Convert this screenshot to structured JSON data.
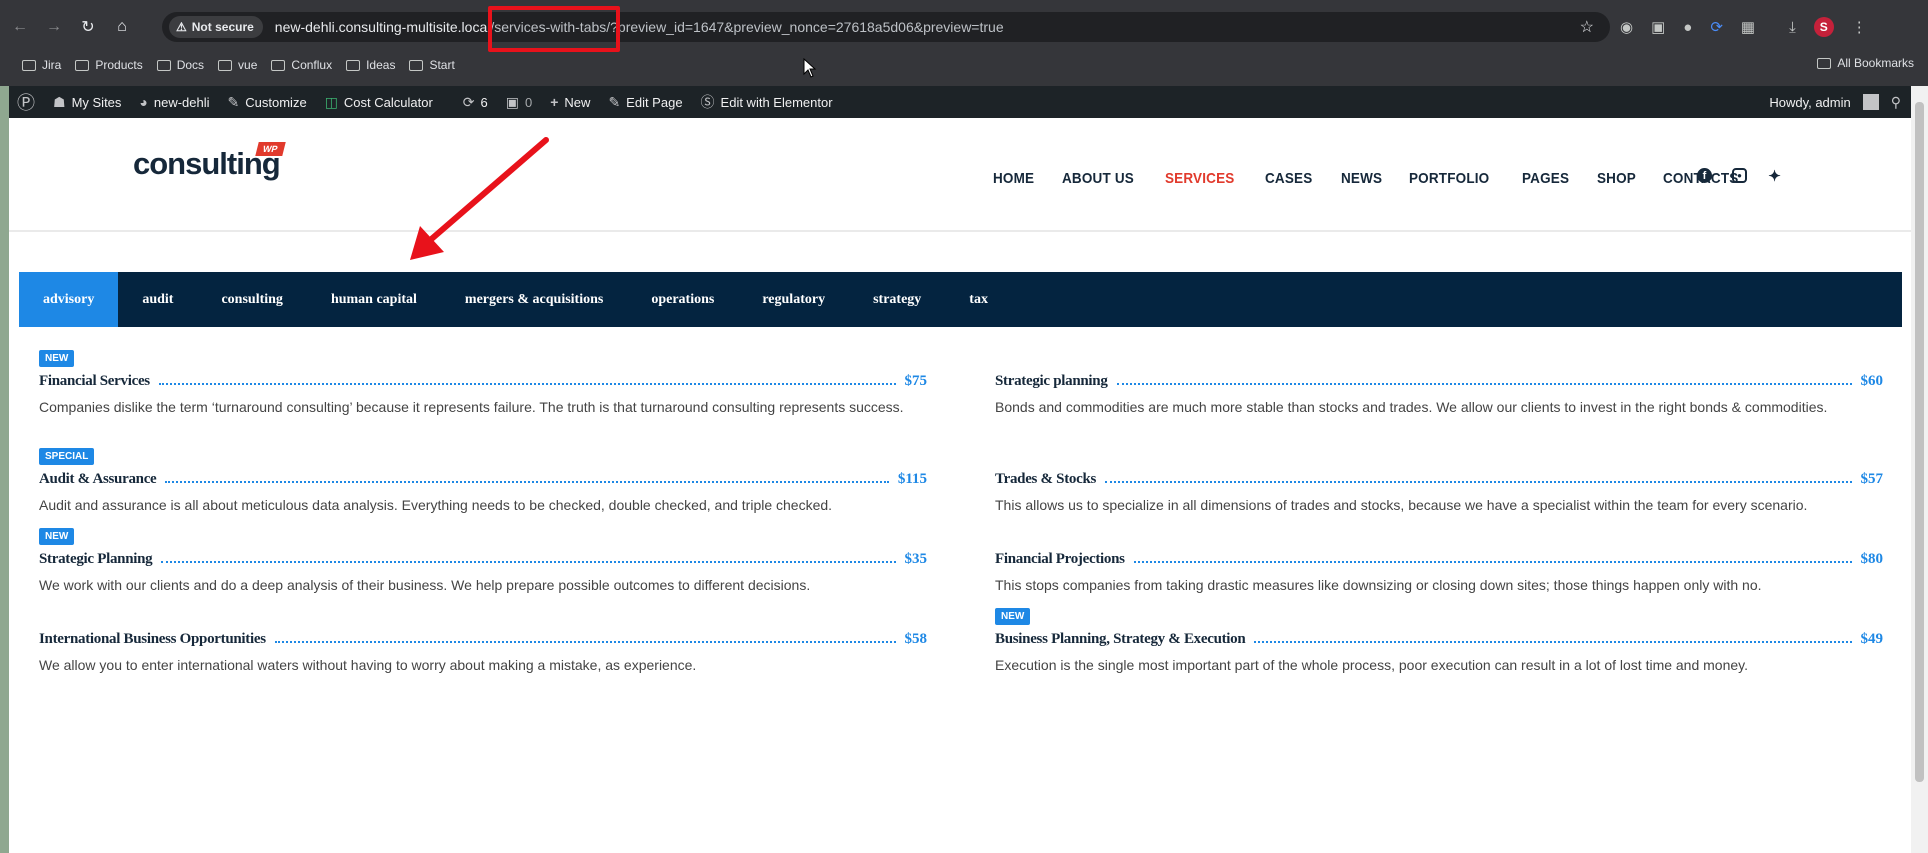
{
  "browser": {
    "security_chip": "Not secure",
    "url_host": "new-dehli.consulting-multisite.local",
    "url_path": "/services-with-tabs/?preview_id=1647&preview_nonce=27618a5d06&preview=true",
    "bookmarks": [
      "Jira",
      "Products",
      "Docs",
      "vue",
      "Conflux",
      "Ideas",
      "Start"
    ],
    "all_bookmarks": "All Bookmarks",
    "profile_initial": "S"
  },
  "adminbar": {
    "my_sites": "My Sites",
    "site_name": "new-dehli",
    "customize": "Customize",
    "cost_calculator": "Cost Calculator",
    "updates_count": "6",
    "comments_count": "0",
    "new": "New",
    "edit_page": "Edit Page",
    "edit_elementor": "Edit with Elementor",
    "howdy": "Howdy, admin"
  },
  "header": {
    "logo_text": "consulting",
    "logo_badge": "WP",
    "nav": [
      "HOME",
      "ABOUT US",
      "SERVICES",
      "CASES",
      "NEWS",
      "PORTFOLIO",
      "PAGES",
      "SHOP",
      "CONTACTS"
    ],
    "active_nav": "SERVICES"
  },
  "tabs": [
    "advisory",
    "audit",
    "consulting",
    "human capital",
    "mergers & acquisitions",
    "operations",
    "regulatory",
    "strategy",
    "tax"
  ],
  "active_tab": "advisory",
  "services": {
    "left": [
      {
        "badge": "NEW",
        "title": "Financial Services",
        "price": "$75",
        "desc": "Companies dislike the term ‘turnaround consulting’ because it represents failure. The truth is that turnaround consulting represents success."
      },
      {
        "badge": "SPECIAL",
        "title": "Audit & Assurance",
        "price": "$115",
        "desc": "Audit and assurance is all about meticulous data analysis. Everything needs to be checked, double checked, and triple checked."
      },
      {
        "badge": "NEW",
        "title": "Strategic Planning",
        "price": "$35",
        "desc": "We work with our clients and do a deep analysis of their business. We help prepare possible outcomes to different decisions."
      },
      {
        "badge": "",
        "title": "International Business Opportunities",
        "price": "$58",
        "desc": "We allow you to enter international waters without having to worry about making a mistake, as experience."
      }
    ],
    "right": [
      {
        "badge": "",
        "title": "Strategic planning",
        "price": "$60",
        "desc": "Bonds and commodities are much more stable than stocks and trades. We allow our clients to invest in the right bonds & commodities."
      },
      {
        "badge": "",
        "title": "Trades & Stocks",
        "price": "$57",
        "desc": "This allows us to specialize in all dimensions of trades and stocks, because we have a specialist within the team for every scenario."
      },
      {
        "badge": "",
        "title": "Financial Projections",
        "price": "$80",
        "desc": "This stops companies from taking drastic measures like downsizing or closing down sites; those things happen only with no."
      },
      {
        "badge": "NEW",
        "title": "Business Planning, Strategy & Execution",
        "price": "$49",
        "desc": "Execution is the single most important part of the whole process, poor execution can result in a lot of lost time and money."
      }
    ]
  },
  "colors": {
    "accent_blue": "#1e88e5",
    "nav_active": "#e13a2c",
    "tabs_bg": "#042440",
    "annotation_red": "#e8121b"
  }
}
